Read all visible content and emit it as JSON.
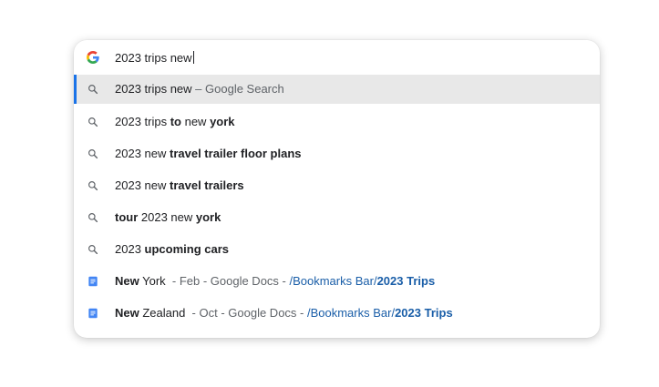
{
  "omnibox": {
    "query": "2023 trips new",
    "suggestions": [
      {
        "icon": "search-icon",
        "parts": [
          {
            "t": "2023 trips new",
            "s": ""
          },
          {
            "t": " – Google Search",
            "s": "muted"
          }
        ]
      },
      {
        "icon": "search-icon",
        "parts": [
          {
            "t": "2023 trips ",
            "s": ""
          },
          {
            "t": "to",
            "s": "b"
          },
          {
            "t": " new ",
            "s": ""
          },
          {
            "t": "york",
            "s": "b"
          }
        ]
      },
      {
        "icon": "search-icon",
        "parts": [
          {
            "t": "2023 new ",
            "s": ""
          },
          {
            "t": "travel trailer floor plans",
            "s": "b"
          }
        ]
      },
      {
        "icon": "search-icon",
        "parts": [
          {
            "t": "2023 new ",
            "s": ""
          },
          {
            "t": "travel trailers",
            "s": "b"
          }
        ]
      },
      {
        "icon": "search-icon",
        "parts": [
          {
            "t": "tour",
            "s": "b"
          },
          {
            "t": " 2023 new ",
            "s": ""
          },
          {
            "t": "york",
            "s": "b"
          }
        ]
      },
      {
        "icon": "search-icon",
        "parts": [
          {
            "t": "2023 ",
            "s": ""
          },
          {
            "t": "upcoming cars",
            "s": "b"
          }
        ]
      },
      {
        "icon": "google-docs-icon",
        "parts": [
          {
            "t": "New",
            "s": "b"
          },
          {
            "t": " York",
            "s": ""
          },
          {
            "t": "  - Feb - Google Docs - ",
            "s": "muted"
          },
          {
            "t": "/Bookmarks Bar/",
            "s": "link"
          },
          {
            "t": "2023 Trips",
            "s": "link-b"
          }
        ]
      },
      {
        "icon": "google-docs-icon",
        "parts": [
          {
            "t": "New",
            "s": "b"
          },
          {
            "t": " Zealand",
            "s": ""
          },
          {
            "t": "  - Oct - Google Docs - ",
            "s": "muted"
          },
          {
            "t": "/Bookmarks Bar/",
            "s": "link"
          },
          {
            "t": "2023 Trips",
            "s": "link-b"
          }
        ]
      }
    ],
    "selected_index": 0
  },
  "colors": {
    "accent": "#1a73e8",
    "link": "#1a5ea8",
    "selected_bg": "#e8e8e8",
    "docs_blue": "#4285f4"
  }
}
